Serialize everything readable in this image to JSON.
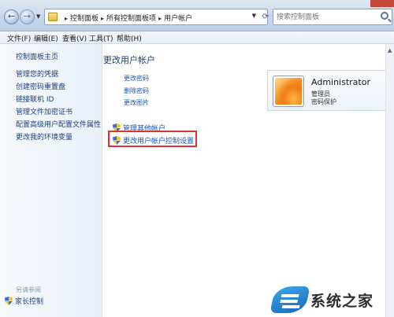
{
  "address_bar": {
    "breadcrumbs": [
      "控制面板",
      "所有控制面板项",
      "用户帐户"
    ],
    "search_placeholder": "搜索控制面板"
  },
  "menu": {
    "items": [
      "文件(F)",
      "编辑(E)",
      "查看(V)",
      "工具(T)",
      "帮助(H)"
    ]
  },
  "sidebar": {
    "home": "控制面板主页",
    "links": [
      "管理您的凭据",
      "创建密码重置盘",
      "链接联机 ID",
      "管理文件加密证书",
      "配置高级用户配置文件属性",
      "更改我的环境变量"
    ],
    "see_also": "另请参阅",
    "parental_control": "家长控制"
  },
  "main": {
    "title": "更改用户帐户",
    "links": [
      "更改密码",
      "删除密码",
      "更改图片"
    ],
    "manage_accounts": "管理其他帐户",
    "uac_settings": "更改用户帐户控制设置"
  },
  "user": {
    "name": "Administrator",
    "role": "管理员",
    "password_status": "密码保护"
  },
  "watermark": {
    "text": "系统之家"
  },
  "colors": {
    "link": "#1a56b5",
    "highlight": "#e0322f",
    "title": "#1d3f70"
  }
}
